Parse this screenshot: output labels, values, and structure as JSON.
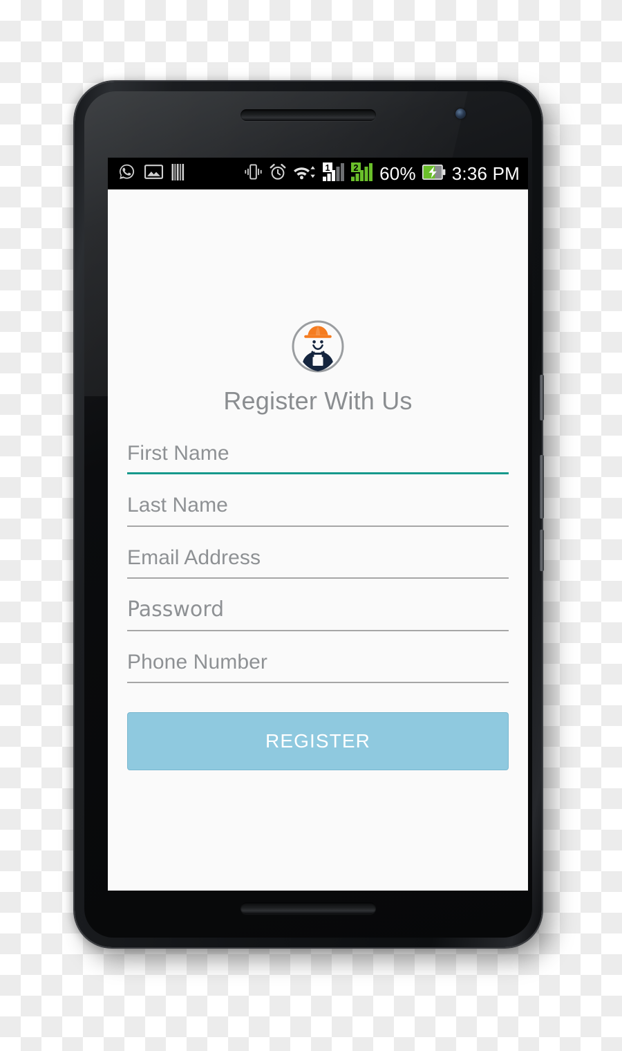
{
  "device": {
    "type": "android-phone-mockup",
    "earpiece_icon": "speaker-grille-icon",
    "camera_icon": "front-camera-icon",
    "power_button_label": "Power",
    "volume_up_label": "Volume Up",
    "volume_down_label": "Volume Down"
  },
  "statusbar": {
    "background_color": "#000000",
    "left_icons": [
      {
        "name": "whatsapp-icon",
        "label": "WhatsApp"
      },
      {
        "name": "gallery-image-icon",
        "label": "Gallery"
      },
      {
        "name": "barcode-icon",
        "label": "Barcode"
      }
    ],
    "right_icons": [
      {
        "name": "vibrate-icon",
        "label": "Vibrate"
      },
      {
        "name": "alarm-clock-icon",
        "label": "Alarm"
      },
      {
        "name": "wifi-icon",
        "label": "Wi-Fi"
      },
      {
        "name": "sim1-signal-icon",
        "label": "SIM 1 Signal",
        "sim": "1",
        "color": "#ffffff"
      },
      {
        "name": "sim2-signal-icon",
        "label": "SIM 2 Signal",
        "sim": "2",
        "color": "#6abf2a"
      }
    ],
    "battery_percent": "60%",
    "battery_icon": "battery-charging-icon",
    "battery_fill_color": "#6abf2a",
    "clock": "3:36 PM"
  },
  "screen": {
    "background_color": "#fafafa",
    "logo": {
      "icon_name": "construction-worker-avatar-icon",
      "helmet_color": "#F57C20",
      "overall_color": "#15253E",
      "ring_color": "#9a9da0",
      "face_color": "#FFFFFF"
    },
    "title": "Register With Us",
    "form": {
      "fields": [
        {
          "name": "first-name-field",
          "placeholder": "First Name",
          "value": "",
          "focused": true,
          "mono": false
        },
        {
          "name": "last-name-field",
          "placeholder": "Last Name",
          "value": "",
          "focused": false,
          "mono": false
        },
        {
          "name": "email-address-field",
          "placeholder": "Email Address",
          "value": "",
          "focused": false,
          "mono": false
        },
        {
          "name": "password-field",
          "placeholder": "Password",
          "value": "",
          "focused": false,
          "mono": true
        },
        {
          "name": "phone-number-field",
          "placeholder": "Phone Number",
          "value": "",
          "focused": false,
          "mono": false
        }
      ],
      "focus_underline_color": "#16998c",
      "idle_underline_color": "#a6a6a6",
      "placeholder_color": "#8e9194"
    },
    "register_button": {
      "label": "REGISTER",
      "background_color": "#8fc9df",
      "text_color": "#ffffff"
    }
  }
}
